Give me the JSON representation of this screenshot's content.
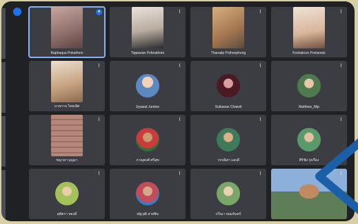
{
  "participants": [
    {
      "name": "Raphaqua Pokathom",
      "mic": "blue"
    },
    {
      "name": "Tippawan Pohnathom",
      "mic": "muted"
    },
    {
      "name": "Thanatip Pothonphong",
      "mic": "muted"
    },
    {
      "name": "Koshakorn Ponlamuk",
      "mic": "muted"
    },
    {
      "name": "นายกาน ไทยเลิศ",
      "mic": "muted"
    },
    {
      "name": "Jiyawat Jumlee",
      "mic": "muted"
    },
    {
      "name": "Suttawan Chaiwit",
      "mic": "muted"
    },
    {
      "name": "Matthew_Mip",
      "mic": "muted"
    },
    {
      "name": "ชญาดา บุญมา",
      "mic": "muted"
    },
    {
      "name": "ภาณุพงศ์ ศรีสุข",
      "mic": "muted"
    },
    {
      "name": "วรรณิสา แสงดี",
      "mic": "muted"
    },
    {
      "name": "ศิริชัย รุ่งเรือง",
      "mic": "muted"
    },
    {
      "name": "สุพัตรา ทองดี",
      "mic": "muted"
    },
    {
      "name": "ณัฐวุฒิ สายพิน",
      "mic": "muted"
    },
    {
      "name": "ปวีณา หอมจันทร์",
      "mic": "muted"
    },
    {
      "name": "",
      "mic": "muted"
    }
  ],
  "icons": {
    "mic_muted": "mic-off-icon",
    "mic_active": "mic-active-icon",
    "pin": "pin-icon"
  },
  "colors": {
    "accent": "#1a73e8",
    "tile_bg": "#3b3d42",
    "grid_bg": "#1f2125",
    "arrow": "#1a5fa8"
  }
}
